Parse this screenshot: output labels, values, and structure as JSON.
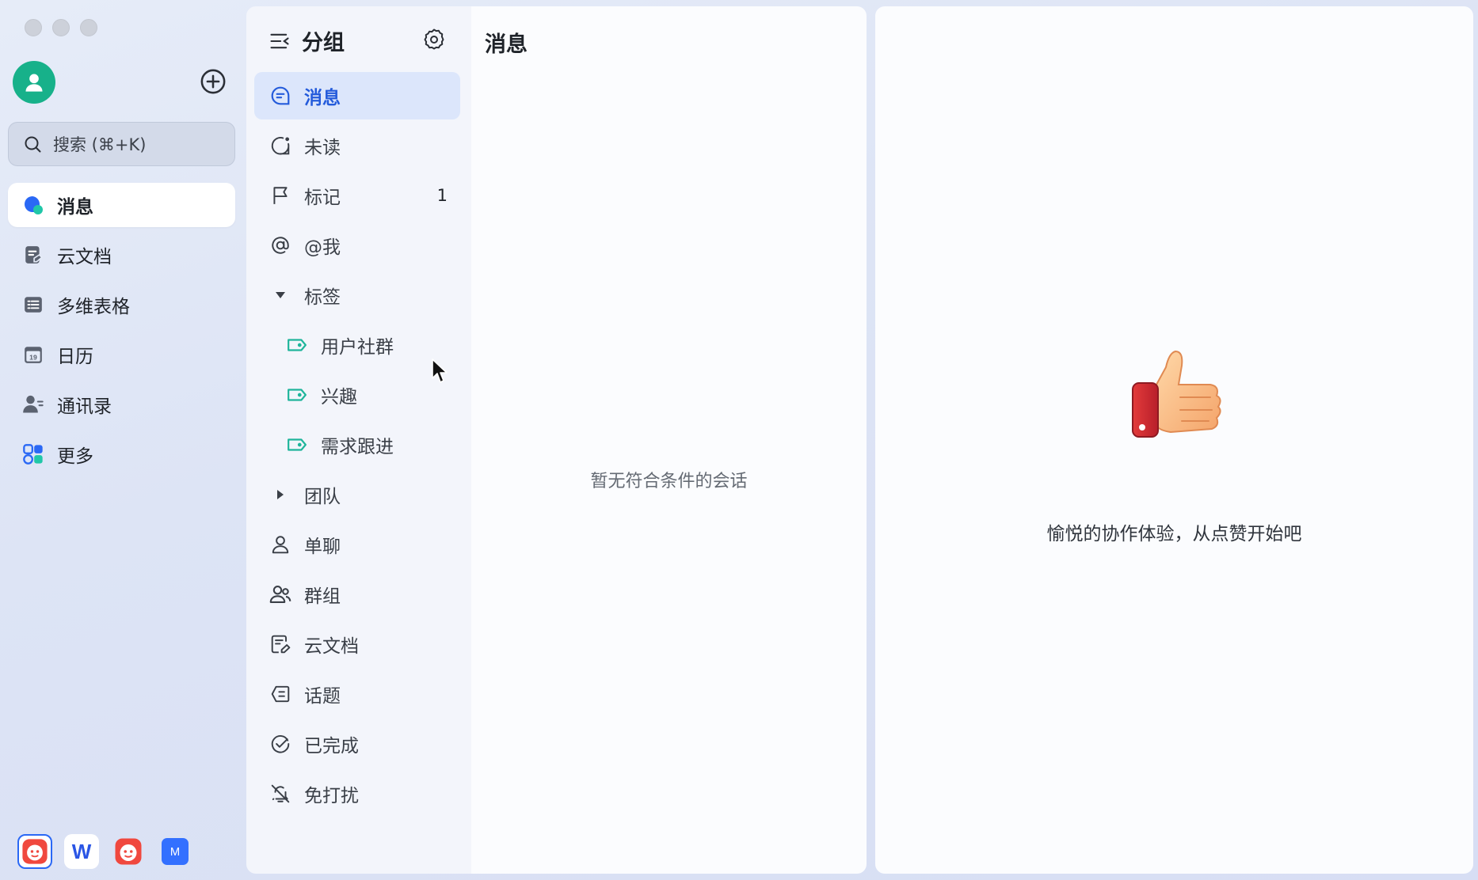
{
  "left_rail": {
    "search_placeholder": "搜索 (⌘+K)",
    "nav": [
      {
        "label": "消息",
        "icon": "chat-bubble-icon",
        "active": true
      },
      {
        "label": "云文档",
        "icon": "doc-icon"
      },
      {
        "label": "多维表格",
        "icon": "table-icon"
      },
      {
        "label": "日历",
        "icon": "calendar-icon",
        "calendar_day": "19"
      },
      {
        "label": "通讯录",
        "icon": "contacts-icon"
      },
      {
        "label": "更多",
        "icon": "apps-icon"
      }
    ],
    "dock_w": "W",
    "dock_m": "M"
  },
  "group_panel": {
    "title": "分组",
    "items": {
      "messages": "消息",
      "unread": "未读",
      "flagged": "标记",
      "flagged_count": "1",
      "mentions": "@我",
      "tags": "标签",
      "tag_community": "用户社群",
      "tag_interest": "兴趣",
      "tag_followup": "需求跟进",
      "teams": "团队",
      "single_chat": "单聊",
      "groups": "群组",
      "docs": "云文档",
      "topics": "话题",
      "done": "已完成",
      "mute": "免打扰"
    }
  },
  "message_panel": {
    "title": "消息",
    "empty_text": "暂无符合条件的会话"
  },
  "content_panel": {
    "text": "愉悦的协作体验，从点赞开始吧"
  },
  "colors": {
    "accent": "#245bdb",
    "active_bg": "#dce6fb",
    "tag_green": "#1fb59b",
    "avatar": "#17b18a"
  }
}
